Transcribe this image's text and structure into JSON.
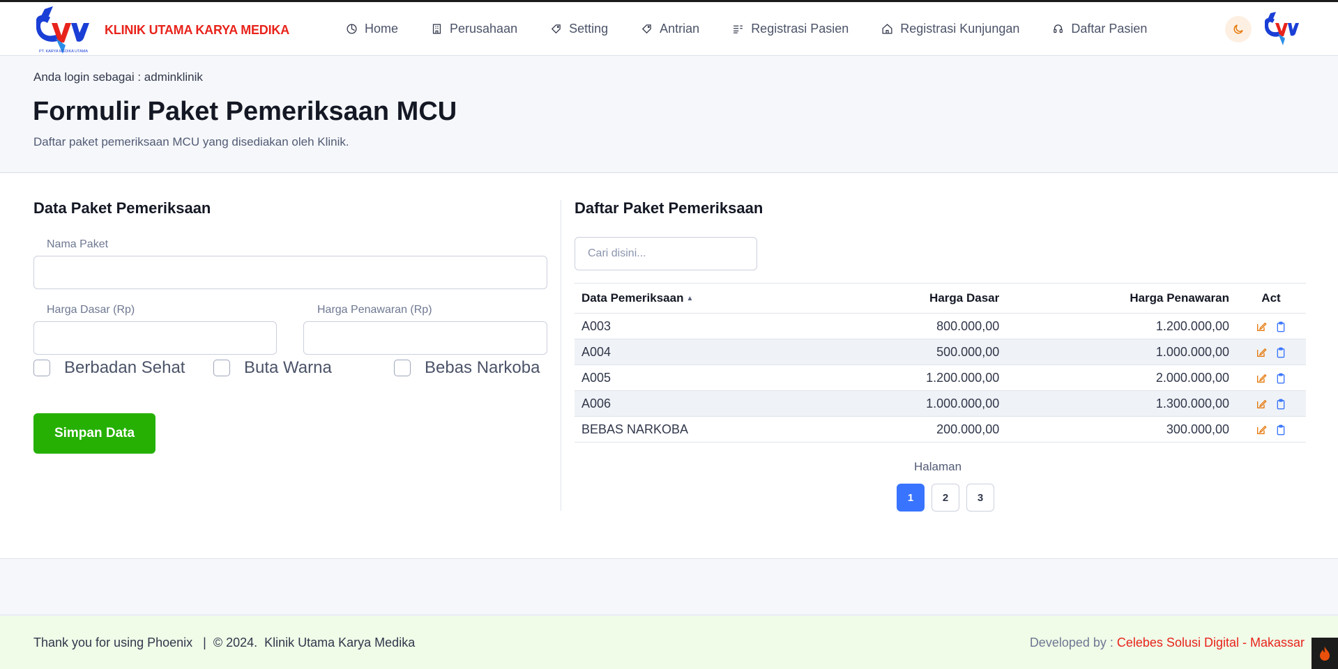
{
  "brand": {
    "name": "KLINIK UTAMA KARYA MEDIKA",
    "logo_caption": "PT. KARYA MEDIKA UTAMA"
  },
  "nav": [
    {
      "label": "Home",
      "icon": "clock-icon"
    },
    {
      "label": "Perusahaan",
      "icon": "building-icon"
    },
    {
      "label": "Setting",
      "icon": "tag-icon"
    },
    {
      "label": "Antrian",
      "icon": "tag-icon"
    },
    {
      "label": "Registrasi Pasien",
      "icon": "list-icon"
    },
    {
      "label": "Registrasi Kunjungan",
      "icon": "home-icon"
    },
    {
      "label": "Daftar Pasien",
      "icon": "headset-icon"
    }
  ],
  "header": {
    "login_info": "Anda login sebagai : adminklinik",
    "title": "Formulir Paket Pemeriksaan MCU",
    "subtitle": "Daftar paket pemeriksaan MCU yang disediakan oleh Klinik."
  },
  "form": {
    "section_title": "Data Paket Pemeriksaan",
    "nama_paket_label": "Nama Paket",
    "nama_paket_value": "",
    "harga_dasar_label": "Harga Dasar (Rp)",
    "harga_dasar_value": "",
    "harga_penawaran_label": "Harga Penawaran (Rp)",
    "harga_penawaran_value": "",
    "checks": [
      "Berbadan Sehat",
      "Buta Warna",
      "Bebas Narkoba"
    ],
    "save_label": "Simpan Data"
  },
  "list": {
    "section_title": "Daftar Paket Pemeriksaan",
    "search_placeholder": "Cari disini...",
    "columns": [
      "Data Pemeriksaan",
      "Harga Dasar",
      "Harga Penawaran",
      "Act"
    ],
    "rows": [
      {
        "name": "A003",
        "harga_dasar": "800.000,00",
        "harga_penawaran": "1.200.000,00"
      },
      {
        "name": "A004",
        "harga_dasar": "500.000,00",
        "harga_penawaran": "1.000.000,00"
      },
      {
        "name": "A005",
        "harga_dasar": "1.200.000,00",
        "harga_penawaran": "2.000.000,00"
      },
      {
        "name": "A006",
        "harga_dasar": "1.000.000,00",
        "harga_penawaran": "1.300.000,00"
      },
      {
        "name": "BEBAS NARKOBA",
        "harga_dasar": "200.000,00",
        "harga_penawaran": "300.000,00"
      }
    ],
    "pager_label": "Halaman",
    "pages": [
      "1",
      "2",
      "3"
    ],
    "active_page": "1"
  },
  "footer": {
    "left": "Thank you for using Phoenix   |  © 2024.  Klinik Utama Karya Medika",
    "developed_by": "Developed by : ",
    "developer": "Celebes Solusi Digital - Makassar"
  },
  "colors": {
    "brand_red": "#e8231b",
    "brand_blue": "#1a3fd6",
    "save_green": "#25b003",
    "page_active": "#3874ff",
    "edit_orange": "#e5780b",
    "copy_blue": "#3874ff"
  }
}
